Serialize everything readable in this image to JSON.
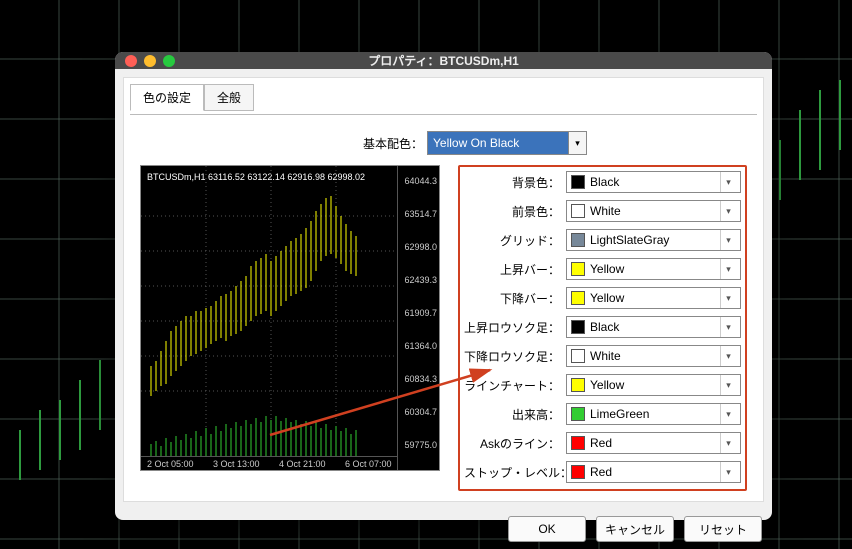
{
  "window": {
    "title": "プロパティ：BTCUSDm,H1"
  },
  "tabs": {
    "colors": "色の設定",
    "general": "全般"
  },
  "scheme": {
    "label": "基本配色：",
    "value": "Yellow On Black"
  },
  "preview": {
    "header": "BTCUSDm,H1  63116.52 63122.14 62916.98 62998.02",
    "yaxis": [
      "64044.3",
      "63514.7",
      "62998.0",
      "62439.3",
      "61909.7",
      "61364.0",
      "60834.3",
      "60304.7",
      "59775.0"
    ],
    "xaxis": [
      {
        "pos": 6,
        "label": "2 Oct 05:00"
      },
      {
        "pos": 72,
        "label": "3 Oct 13:00"
      },
      {
        "pos": 138,
        "label": "4 Oct 21:00"
      },
      {
        "pos": 204,
        "label": "6 Oct 07:00"
      }
    ]
  },
  "colors": [
    {
      "label": "背景色：",
      "name": "Black",
      "hex": "#000000"
    },
    {
      "label": "前景色：",
      "name": "White",
      "hex": "#ffffff"
    },
    {
      "label": "グリッド：",
      "name": "LightSlateGray",
      "hex": "#778899"
    },
    {
      "label": "上昇バー：",
      "name": "Yellow",
      "hex": "#ffff00"
    },
    {
      "label": "下降バー：",
      "name": "Yellow",
      "hex": "#ffff00"
    },
    {
      "label": "上昇ロウソク足：",
      "name": "Black",
      "hex": "#000000"
    },
    {
      "label": "下降ロウソク足：",
      "name": "White",
      "hex": "#ffffff"
    },
    {
      "label": "ラインチャート：",
      "name": "Yellow",
      "hex": "#ffff00"
    },
    {
      "label": "出来高：",
      "name": "LimeGreen",
      "hex": "#32cd32"
    },
    {
      "label": "Askのライン：",
      "name": "Red",
      "hex": "#ff0000"
    },
    {
      "label": "ストップ・レベル：",
      "name": "Red",
      "hex": "#ff0000"
    }
  ],
  "buttons": {
    "ok": "OK",
    "cancel": "キャンセル",
    "reset": "リセット"
  },
  "chart_data": {
    "type": "bar",
    "title": "BTCUSDm,H1",
    "ohlc_last": {
      "open": 63116.52,
      "high": 63122.14,
      "low": 62916.98,
      "close": 62998.02
    },
    "ylim": [
      59775.0,
      64044.3
    ],
    "yticks": [
      64044.3,
      63514.7,
      62998.0,
      62439.3,
      61909.7,
      61364.0,
      60834.3,
      60304.7,
      59775.0
    ],
    "x_categories": [
      "2 Oct 05:00",
      "3 Oct 13:00",
      "4 Oct 21:00",
      "6 Oct 07:00"
    ]
  }
}
